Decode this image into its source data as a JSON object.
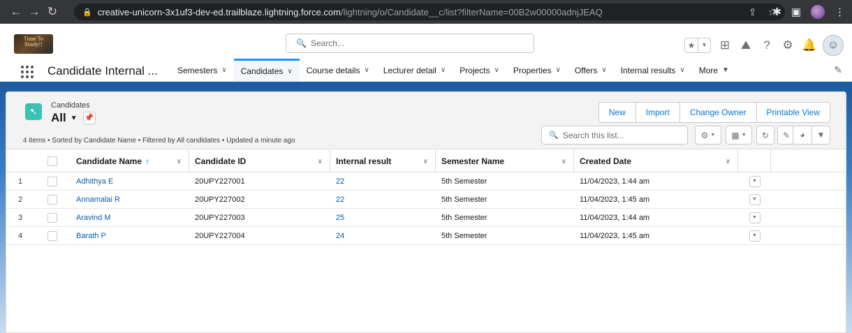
{
  "browser": {
    "url_host": "creative-unicorn-3x1uf3-dev-ed.trailblaze.lightning.force.com",
    "url_path": "/lightning/o/Candidate__c/list?filterName=00B2w00000adnjJEAQ"
  },
  "header": {
    "logo_text": "Time To Study!!",
    "search_placeholder": "Search..."
  },
  "app": {
    "name": "Candidate Internal ...",
    "nav": [
      {
        "label": "Semesters"
      },
      {
        "label": "Candidates"
      },
      {
        "label": "Course details"
      },
      {
        "label": "Lecturer detail"
      },
      {
        "label": "Projects"
      },
      {
        "label": "Properties"
      },
      {
        "label": "Offers"
      },
      {
        "label": "Internal results"
      },
      {
        "label": "More"
      }
    ]
  },
  "list_view": {
    "object_label": "Candidates",
    "view_name": "All",
    "status": "4 items • Sorted by Candidate Name • Filtered by All candidates • Updated a minute ago",
    "actions": [
      "New",
      "Import",
      "Change Owner",
      "Printable View"
    ],
    "search_placeholder": "Search this list...",
    "columns": [
      "Candidate Name",
      "Candidate ID",
      "Internal result",
      "Semester Name",
      "Created Date"
    ],
    "sort_arrow": "↑",
    "rows": [
      {
        "num": "1",
        "name": "Adhithya E",
        "id": "20UPY227001",
        "result": "22",
        "semester": "5th Semester",
        "created": "11/04/2023, 1:44 am"
      },
      {
        "num": "2",
        "name": "Annamalai R",
        "id": "20UPY227002",
        "result": "22",
        "semester": "5th Semester",
        "created": "11/04/2023, 1:45 am"
      },
      {
        "num": "3",
        "name": "Aravind M",
        "id": "20UPY227003",
        "result": "25",
        "semester": "5th Semester",
        "created": "11/04/2023, 1:44 am"
      },
      {
        "num": "4",
        "name": "Barath P",
        "id": "20UPY227004",
        "result": "24",
        "semester": "5th Semester",
        "created": "11/04/2023, 1:45 am"
      }
    ]
  },
  "colors": {
    "brand_blue": "#0176d3",
    "link_blue": "#0b5cab",
    "object_icon": "#3bc1b4",
    "nav_bar_accent": "#1b5fa6"
  }
}
